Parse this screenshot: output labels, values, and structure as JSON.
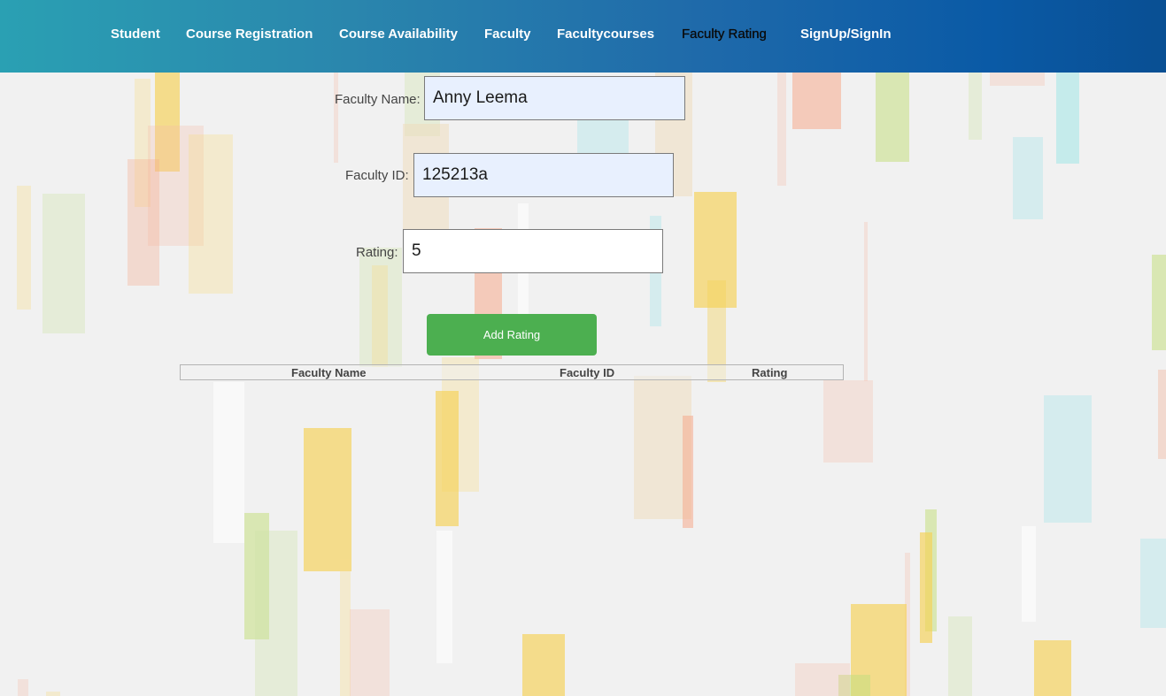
{
  "nav": {
    "items": [
      {
        "label": "Student"
      },
      {
        "label": "Course Registration"
      },
      {
        "label": "Course Availability"
      },
      {
        "label": "Faculty"
      },
      {
        "label": "Facultycourses"
      },
      {
        "label": "Faculty Rating"
      },
      {
        "label": "SignUp/SignIn"
      }
    ],
    "active": "Faculty Rating",
    "gradient_colors": [
      "#2aa0b3",
      "#094f93"
    ]
  },
  "form": {
    "faculty_name": {
      "label": "Faculty Name:",
      "value": "Anny Leema"
    },
    "faculty_id": {
      "label": "Faculty ID:",
      "value": "125213a"
    },
    "rating": {
      "label": "Rating:",
      "value": "5"
    },
    "submit_label": "Add Rating",
    "submit_color": "#4caf50"
  },
  "table": {
    "columns": [
      "Faculty Name",
      "Faculty ID",
      "Rating"
    ],
    "rows": []
  }
}
